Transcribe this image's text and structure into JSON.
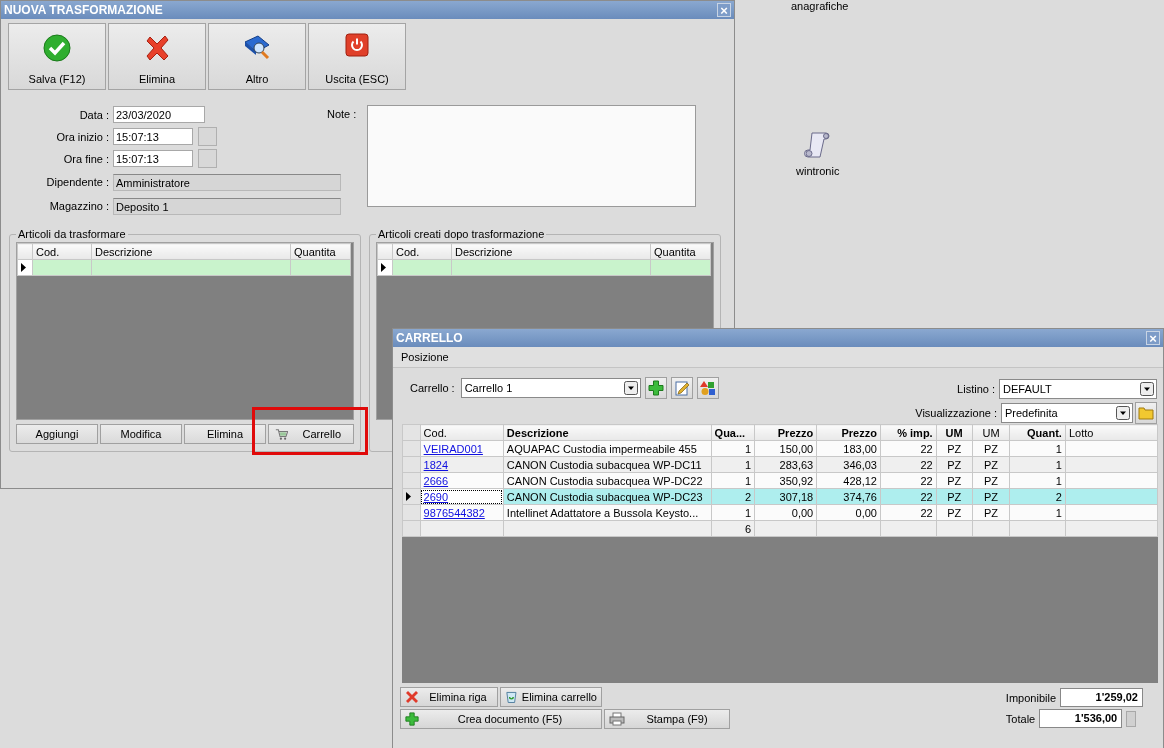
{
  "desktop": {
    "items": [
      {
        "label": "anagrafiche",
        "kind": "text"
      },
      {
        "label": "wintronic",
        "kind": "scroll"
      }
    ]
  },
  "main_window": {
    "title": "NUOVA TRASFORMAZIONE",
    "close": "×",
    "toolbar": [
      {
        "label": "Salva (F12)",
        "kind": "check"
      },
      {
        "label": "Elimina",
        "kind": "cross"
      },
      {
        "label": "Altro",
        "kind": "search"
      },
      {
        "label": "Uscita (ESC)",
        "kind": "power"
      }
    ],
    "form": [
      {
        "label": "Data :",
        "value": "23/03/2020",
        "kind": "date"
      },
      {
        "label": "Ora inizio :",
        "value": "15:07:13",
        "kind": "time"
      },
      {
        "label": "Ora fine :",
        "value": "15:07:13",
        "kind": "time"
      },
      {
        "label": "Dipendente :",
        "value": "Amministratore",
        "kind": "readonly"
      },
      {
        "label": "Magazzino :",
        "value": "Deposito 1",
        "kind": "readonly"
      }
    ],
    "note": {
      "label": "Note :"
    },
    "groups": [
      {
        "title": "Articoli da trasformare",
        "columns": [
          "Cod.",
          "Descrizione",
          "Quantita"
        ],
        "current_row": true,
        "buttons": [
          {
            "label": "Aggiungi",
            "kind": "text",
            "highlighted": false
          },
          {
            "label": "Modifica",
            "kind": "text",
            "highlighted": false
          },
          {
            "label": "Elimina",
            "kind": "text",
            "highlighted": false
          },
          {
            "label": "Carrello",
            "kind": "cart",
            "highlighted": true
          }
        ]
      },
      {
        "title": "Articoli creati dopo trasformazione",
        "columns": [
          "Cod.",
          "Descrizione",
          "Quantita"
        ],
        "current_row": true
      }
    ]
  },
  "cart_window": {
    "title": "CARRELLO",
    "close": "×",
    "menu": [
      {
        "label": "Posizione"
      }
    ],
    "cart": {
      "label": "Carrello :",
      "value": "Carrello 1"
    },
    "cart_tools": [
      {
        "kind": "add"
      },
      {
        "kind": "edit"
      },
      {
        "kind": "shapes"
      }
    ],
    "listino": {
      "label": "Listino :",
      "value": "DEFAULT"
    },
    "view": {
      "label": "Visualizzazione :",
      "value": "Predefinita"
    },
    "table": {
      "columns": [
        "Cod.",
        "Descrizione",
        "Qua...",
        "Prezzo",
        "Prezzo",
        "% imp.",
        "UM",
        "UM",
        "Quant.",
        "Lotto"
      ],
      "rows": [
        {
          "cells": [
            "VEIRAD001",
            "AQUAPAC Custodia impermeabile 455",
            "1",
            "150,00",
            "183,00",
            "22",
            "PZ",
            "PZ",
            "1"
          ],
          "selected": false
        },
        {
          "cells": [
            "1824",
            "CANON Custodia subacquea WP-DC11",
            "1",
            "283,63",
            "346,03",
            "22",
            "PZ",
            "PZ",
            "1"
          ],
          "selected": false
        },
        {
          "cells": [
            "2666",
            "CANON Custodia subacquea WP-DC22",
            "1",
            "350,92",
            "428,12",
            "22",
            "PZ",
            "PZ",
            "1"
          ],
          "selected": false
        },
        {
          "cells": [
            "2690",
            "CANON Custodia subacquea WP-DC23",
            "2",
            "307,18",
            "374,76",
            "22",
            "PZ",
            "PZ",
            "2"
          ],
          "selected": true
        },
        {
          "cells": [
            "9876544382",
            "Intellinet Adattatore a Bussola Keysto...",
            "1",
            "0,00",
            "0,00",
            "22",
            "PZ",
            "PZ",
            "1"
          ],
          "selected": false
        }
      ],
      "total_quantity": "6"
    },
    "actions": [
      {
        "label": "Elimina riga",
        "kind": "delete"
      },
      {
        "label": "Elimina carrello",
        "kind": "bin"
      },
      {
        "label": "Crea documento (F5)",
        "kind": "add"
      },
      {
        "label": "Stampa (F9)",
        "kind": "print"
      }
    ],
    "totals": [
      {
        "label": "Imponibile",
        "value": "1'259,02",
        "extra_box": false
      },
      {
        "label": "Totale",
        "value": "1'536,00",
        "extra_box": true
      }
    ]
  }
}
